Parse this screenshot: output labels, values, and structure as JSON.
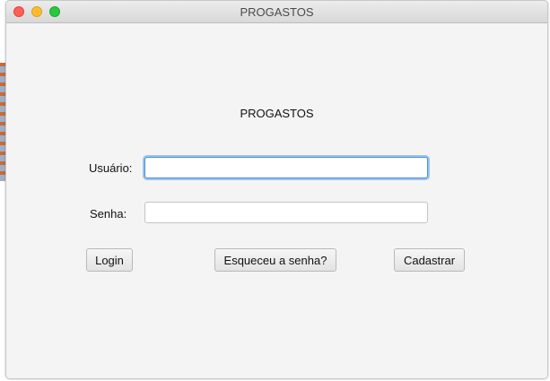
{
  "window": {
    "title": "PROGASTOS"
  },
  "form": {
    "heading": "PROGASTOS",
    "username": {
      "label": "Usuário:",
      "value": "",
      "placeholder": ""
    },
    "password": {
      "label": "Senha:",
      "value": "",
      "placeholder": ""
    }
  },
  "actions": {
    "login_label": "Login",
    "forgot_label": "Esqueceu a senha?",
    "register_label": "Cadastrar"
  }
}
